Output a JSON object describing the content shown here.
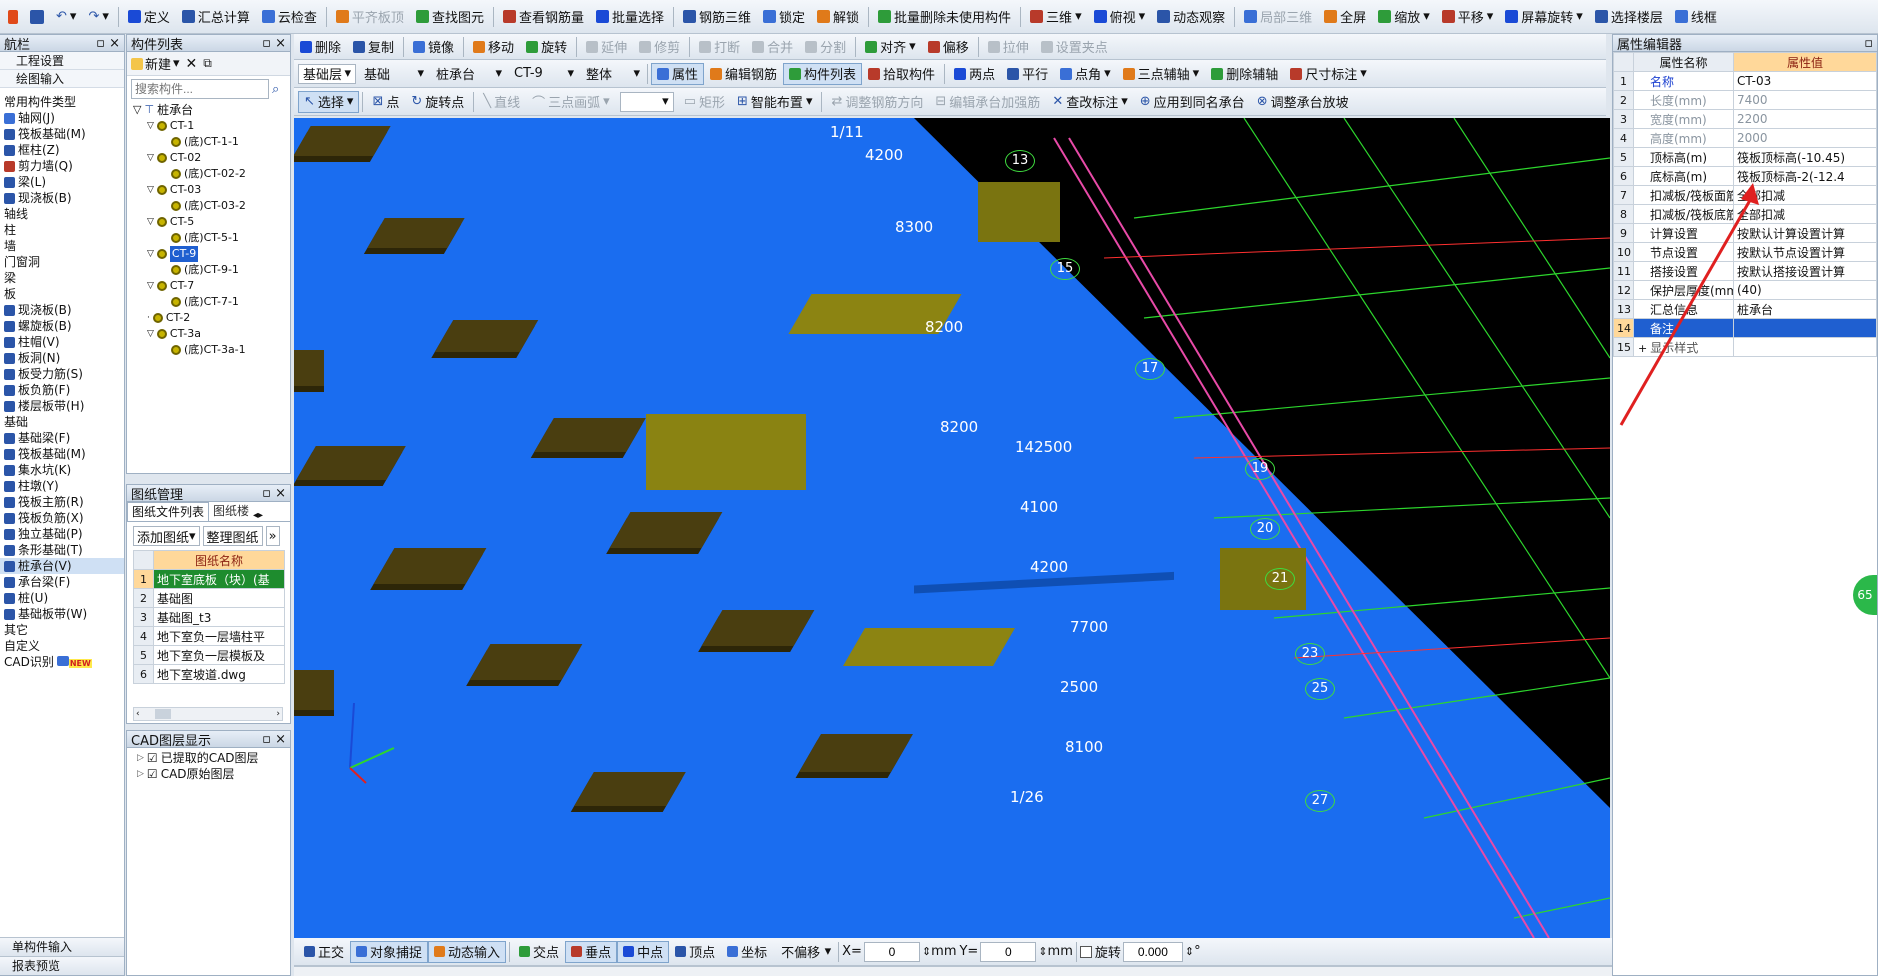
{
  "menubar": {
    "items": [
      "定义",
      "汇总计算",
      "云检查",
      "平齐板顶",
      "查找图元",
      "查看钢筋量",
      "批量选择",
      "钢筋三维",
      "锁定",
      "解锁",
      "批量删除未使用构件",
      "三维",
      "俯视",
      "动态观察",
      "局部三维",
      "全屏",
      "缩放",
      "平移",
      "屏幕旋转",
      "选择楼层",
      "线框"
    ]
  },
  "edit_toolbar": {
    "items": [
      "删除",
      "复制",
      "镜像",
      "移动",
      "旋转",
      "延伸",
      "修剪",
      "打断",
      "合并",
      "分割",
      "对齐",
      "偏移",
      "拉伸",
      "设置夹点"
    ]
  },
  "layer_toolbar": {
    "floor": "基础层",
    "category": "基础",
    "type": "桩承台",
    "component": "CT-9",
    "mode": "整体",
    "items": [
      "属性",
      "编辑钢筋",
      "构件列表",
      "拾取构件",
      "两点",
      "平行",
      "点角",
      "三点辅轴",
      "删除辅轴",
      "尺寸标注"
    ]
  },
  "draw_toolbar": {
    "items": [
      "选择",
      "点",
      "旋转点",
      "直线",
      "三点画弧",
      "矩形",
      "智能布置",
      "调整钢筋方向",
      "编辑承台加强筋",
      "查改标注",
      "应用到同名承台",
      "调整承台放坡"
    ]
  },
  "nav": {
    "title": "航栏",
    "top": [
      "工程设置",
      "绘图输入"
    ],
    "items": [
      {
        "t": "c",
        "label": "常用构件类型"
      },
      {
        "t": "i",
        "label": "轴网(J)",
        "color": "#3a6fd6"
      },
      {
        "t": "i",
        "label": "筏板基础(M)",
        "color": "#2b55a8"
      },
      {
        "t": "i",
        "label": "框柱(Z)",
        "color": "#2b55a8"
      },
      {
        "t": "i",
        "label": "剪力墙(Q)",
        "color": "#b83a2a"
      },
      {
        "t": "i",
        "label": "梁(L)",
        "color": "#2b55a8"
      },
      {
        "t": "i",
        "label": "现浇板(B)",
        "color": "#2b55a8"
      },
      {
        "t": "c",
        "label": "轴线"
      },
      {
        "t": "c",
        "label": "柱"
      },
      {
        "t": "c",
        "label": "墙"
      },
      {
        "t": "c",
        "label": "门窗洞"
      },
      {
        "t": "c",
        "label": "梁"
      },
      {
        "t": "c",
        "label": "板"
      },
      {
        "t": "i",
        "label": "现浇板(B)",
        "color": "#2b55a8"
      },
      {
        "t": "i",
        "label": "螺旋板(B)",
        "color": "#2b55a8"
      },
      {
        "t": "i",
        "label": "柱帽(V)",
        "color": "#2b55a8"
      },
      {
        "t": "i",
        "label": "板洞(N)",
        "color": "#2b55a8"
      },
      {
        "t": "i",
        "label": "板受力筋(S)",
        "color": "#2b55a8"
      },
      {
        "t": "i",
        "label": "板负筋(F)",
        "color": "#2b55a8"
      },
      {
        "t": "i",
        "label": "楼层板带(H)",
        "color": "#2b55a8"
      },
      {
        "t": "c",
        "label": "基础"
      },
      {
        "t": "i",
        "label": "基础梁(F)",
        "color": "#2b55a8"
      },
      {
        "t": "i",
        "label": "筏板基础(M)",
        "color": "#2b55a8"
      },
      {
        "t": "i",
        "label": "集水坑(K)",
        "color": "#2b55a8"
      },
      {
        "t": "i",
        "label": "柱墩(Y)",
        "color": "#2b55a8"
      },
      {
        "t": "i",
        "label": "筏板主筋(R)",
        "color": "#2b55a8"
      },
      {
        "t": "i",
        "label": "筏板负筋(X)",
        "color": "#2b55a8"
      },
      {
        "t": "i",
        "label": "独立基础(P)",
        "color": "#2b55a8"
      },
      {
        "t": "i",
        "label": "条形基础(T)",
        "color": "#2b55a8"
      },
      {
        "t": "i",
        "label": "桩承台(V)",
        "color": "#2b55a8",
        "sel": true
      },
      {
        "t": "i",
        "label": "承台梁(F)",
        "color": "#2b55a8"
      },
      {
        "t": "i",
        "label": "桩(U)",
        "color": "#2b55a8"
      },
      {
        "t": "i",
        "label": "基础板带(W)",
        "color": "#2b55a8"
      },
      {
        "t": "c",
        "label": "其它"
      },
      {
        "t": "c",
        "label": "自定义"
      },
      {
        "t": "c",
        "label": "CAD识别"
      }
    ],
    "new_badge": "NEW",
    "bottom": [
      "单构件输入",
      "报表预览"
    ]
  },
  "complist": {
    "title": "构件列表",
    "new_label": "新建",
    "search_placeholder": "搜索构件...",
    "root": "桩承台",
    "items": [
      {
        "label": "CT-1",
        "child": "(底)CT-1-1"
      },
      {
        "label": "CT-02",
        "child": "(底)CT-02-2"
      },
      {
        "label": "CT-03",
        "child": "(底)CT-03-2"
      },
      {
        "label": "CT-5",
        "child": "(底)CT-5-1"
      },
      {
        "label": "CT-9",
        "child": "(底)CT-9-1",
        "sel": true
      },
      {
        "label": "CT-7",
        "child": "(底)CT-7-1"
      },
      {
        "label": "CT-2",
        "child": ""
      },
      {
        "label": "CT-3a",
        "child": "(底)CT-3a-1"
      }
    ]
  },
  "drawings": {
    "title": "图纸管理",
    "tabs": [
      "图纸文件列表",
      "图纸楼"
    ],
    "add_label": "添加图纸",
    "arrange_label": "整理图纸",
    "col": "图纸名称",
    "rows": [
      {
        "n": "1",
        "name": "地下室底板（块）(基"
      },
      {
        "n": "2",
        "name": "基础图"
      },
      {
        "n": "3",
        "name": "基础图_t3"
      },
      {
        "n": "4",
        "name": "地下室负一层墙柱平"
      },
      {
        "n": "5",
        "name": "地下室负一层模板及"
      },
      {
        "n": "6",
        "name": "地下室坡道.dwg"
      }
    ]
  },
  "cadlayers": {
    "title": "CAD图层显示",
    "items": [
      "已提取的CAD图层",
      "CAD原始图层"
    ]
  },
  "props": {
    "title": "属性编辑器",
    "col_name": "属性名称",
    "col_value": "属性值",
    "rows": [
      {
        "n": "1",
        "name": "名称",
        "value": "CT-03",
        "kind": "blue"
      },
      {
        "n": "2",
        "name": "长度(mm)",
        "value": "7400",
        "kind": "gray"
      },
      {
        "n": "3",
        "name": "宽度(mm)",
        "value": "2200",
        "kind": "gray"
      },
      {
        "n": "4",
        "name": "高度(mm)",
        "value": "2000",
        "kind": "gray"
      },
      {
        "n": "5",
        "name": "顶标高(m)",
        "value": "筏板顶标高(-10.45)",
        "kind": ""
      },
      {
        "n": "6",
        "name": "底标高(m)",
        "value": "筏板顶标高-2(-12.4",
        "kind": ""
      },
      {
        "n": "7",
        "name": "扣减板/筏板面筋",
        "value": "全部扣减",
        "kind": ""
      },
      {
        "n": "8",
        "name": "扣减板/筏板底筋",
        "value": "全部扣减",
        "kind": ""
      },
      {
        "n": "9",
        "name": "计算设置",
        "value": "按默认计算设置计算",
        "kind": ""
      },
      {
        "n": "10",
        "name": "节点设置",
        "value": "按默认节点设置计算",
        "kind": ""
      },
      {
        "n": "11",
        "name": "搭接设置",
        "value": "按默认搭接设置计算",
        "kind": ""
      },
      {
        "n": "12",
        "name": "保护层厚度(mm)",
        "value": "(40)",
        "kind": ""
      },
      {
        "n": "13",
        "name": "汇总信息",
        "value": "桩承台",
        "kind": ""
      },
      {
        "n": "14",
        "name": "备注",
        "value": "",
        "kind": "sel"
      },
      {
        "n": "15",
        "name": "显示样式",
        "value": "",
        "kind": "plus"
      }
    ]
  },
  "statusbar": {
    "items": [
      "正交",
      "对象捕捉",
      "动态输入",
      "交点",
      "垂点",
      "中点",
      "顶点",
      "坐标"
    ],
    "offset_mode": "不偏移",
    "x_label": "X=",
    "x_value": "0",
    "y_label": "Y=",
    "y_value": "0",
    "unit": "mm",
    "rotate_label": "旋转",
    "rotate_value": "0.000",
    "deg": "°"
  },
  "canvas": {
    "labels": [
      "1/11",
      "4200",
      "13",
      "8300",
      "15",
      "8200",
      "17",
      "8200",
      "142500",
      "19",
      "4100",
      "20",
      "4200",
      "21",
      "7700",
      "23",
      "2500",
      "25",
      "8100",
      "1/26",
      "27"
    ]
  },
  "side_badge": "65"
}
